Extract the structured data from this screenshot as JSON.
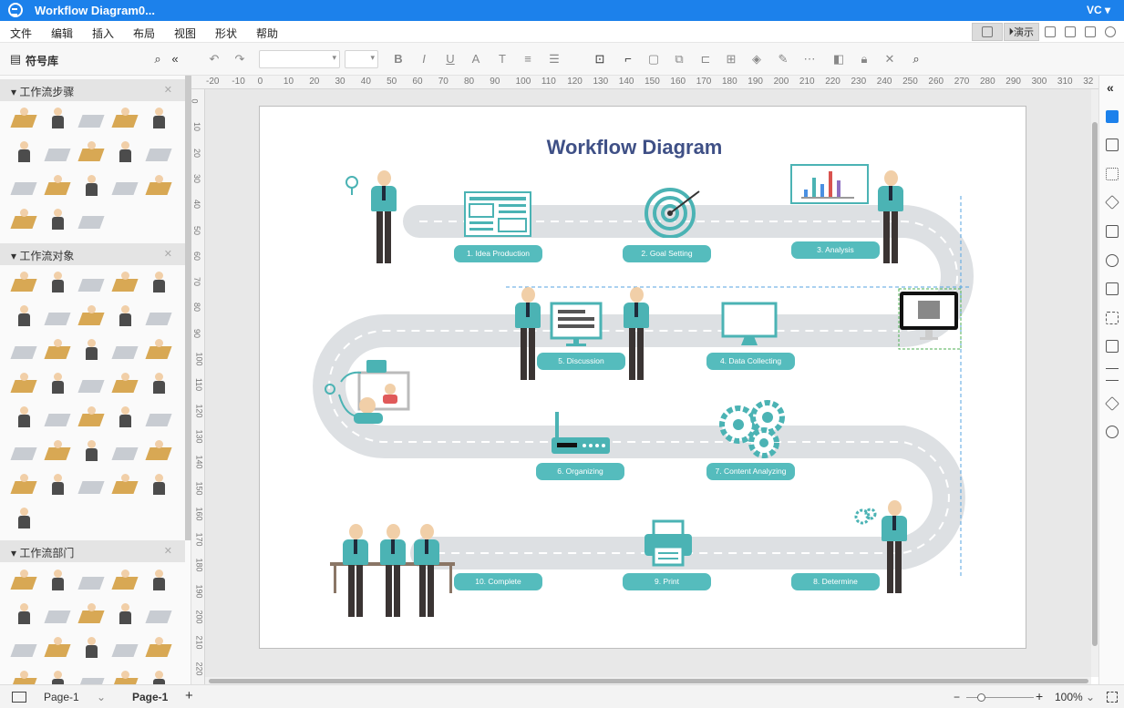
{
  "titlebar": {
    "title": "Workflow Diagram0...",
    "user": "VC ▾"
  },
  "menu": [
    "文件",
    "编辑",
    "插入",
    "布局",
    "视图",
    "形状",
    "帮助"
  ],
  "actions": {
    "present": "演示"
  },
  "library": {
    "title": "符号库",
    "sections": [
      "工作流步骤",
      "工作流对象",
      "工作流部门"
    ]
  },
  "ruler_top": [
    "-20",
    "-10",
    "0",
    "10",
    "20",
    "30",
    "40",
    "50",
    "60",
    "70",
    "80",
    "90",
    "100",
    "110",
    "120",
    "130",
    "140",
    "150",
    "160",
    "170",
    "180",
    "190",
    "200",
    "210",
    "220",
    "230",
    "240",
    "250",
    "260",
    "270",
    "280",
    "290",
    "300",
    "310",
    "32"
  ],
  "ruler_left": [
    "0",
    "10",
    "20",
    "30",
    "40",
    "50",
    "60",
    "70",
    "80",
    "90",
    "100",
    "110",
    "120",
    "130",
    "140",
    "150",
    "160",
    "170",
    "180",
    "190",
    "200",
    "210",
    "220"
  ],
  "diagram": {
    "title": "Workflow Diagram",
    "steps": [
      "1. Idea Production",
      "2. Goal Setting",
      "3. Analysis",
      "4. Data Collecting",
      "5. Discussion",
      "6. Organizing",
      "7. Content Analyzing",
      "8. Determine",
      "9. Print",
      "10. Complete"
    ]
  },
  "status": {
    "page_tab": "Page-1",
    "active_page": "Page-1",
    "zoom": "100%"
  },
  "colors": {
    "titlebar": "#1c81eb",
    "teal": "#55bcbd",
    "road": "#dde0e3",
    "title": "#3f5086"
  }
}
